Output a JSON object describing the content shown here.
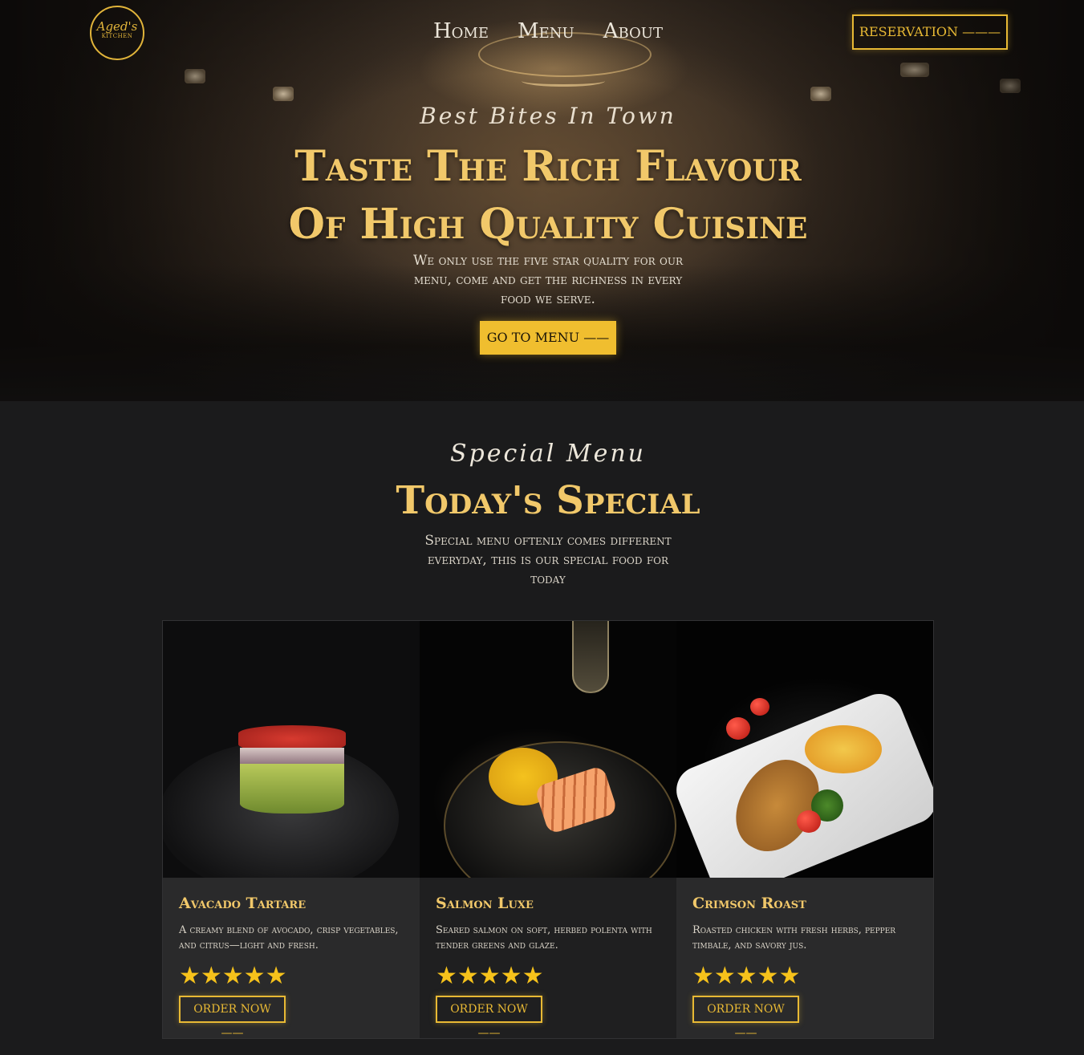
{
  "brand": {
    "logo_top": "Aged's",
    "logo_bottom": "KITCHEN",
    "accent_color": "#f0be2f"
  },
  "nav": {
    "items": [
      "Home",
      "Menu",
      "About"
    ],
    "reservation_label": "RESERVATION ———"
  },
  "hero": {
    "eyebrow": "Best Bites In Town",
    "title_line1": "Taste The Rich Flavour",
    "title_line2": "Of High Quality Cuisine",
    "description": "We only use the five star quality for our menu, come and get the richness in every food we serve.",
    "cta_label": "GO TO MENU ——"
  },
  "special": {
    "eyebrow": "Special Menu",
    "title": "Today's Special",
    "description": "Special menu oftenly comes different everyday, this is our special food for today",
    "items": [
      {
        "name": "Avacado Tartare",
        "description": "A creamy blend of avocado, crisp vegetables, and citrus—light and fresh.",
        "rating": 5,
        "stars": "★★★★★",
        "order_label": "ORDER NOW ——",
        "image_icon": "avocado-tartare-photo"
      },
      {
        "name": "Salmon Luxe",
        "description": "Seared salmon on soft, herbed polenta with tender greens and glaze.",
        "rating": 5,
        "stars": "★★★★★",
        "order_label": "ORDER NOW ——",
        "image_icon": "salmon-plate-photo"
      },
      {
        "name": "Crimson Roast",
        "description": "Roasted chicken with fresh herbs, pepper timbale, and savory jus.",
        "rating": 5,
        "stars": "★★★★★",
        "order_label": "ORDER NOW ——",
        "image_icon": "roast-chicken-photo"
      }
    ]
  }
}
